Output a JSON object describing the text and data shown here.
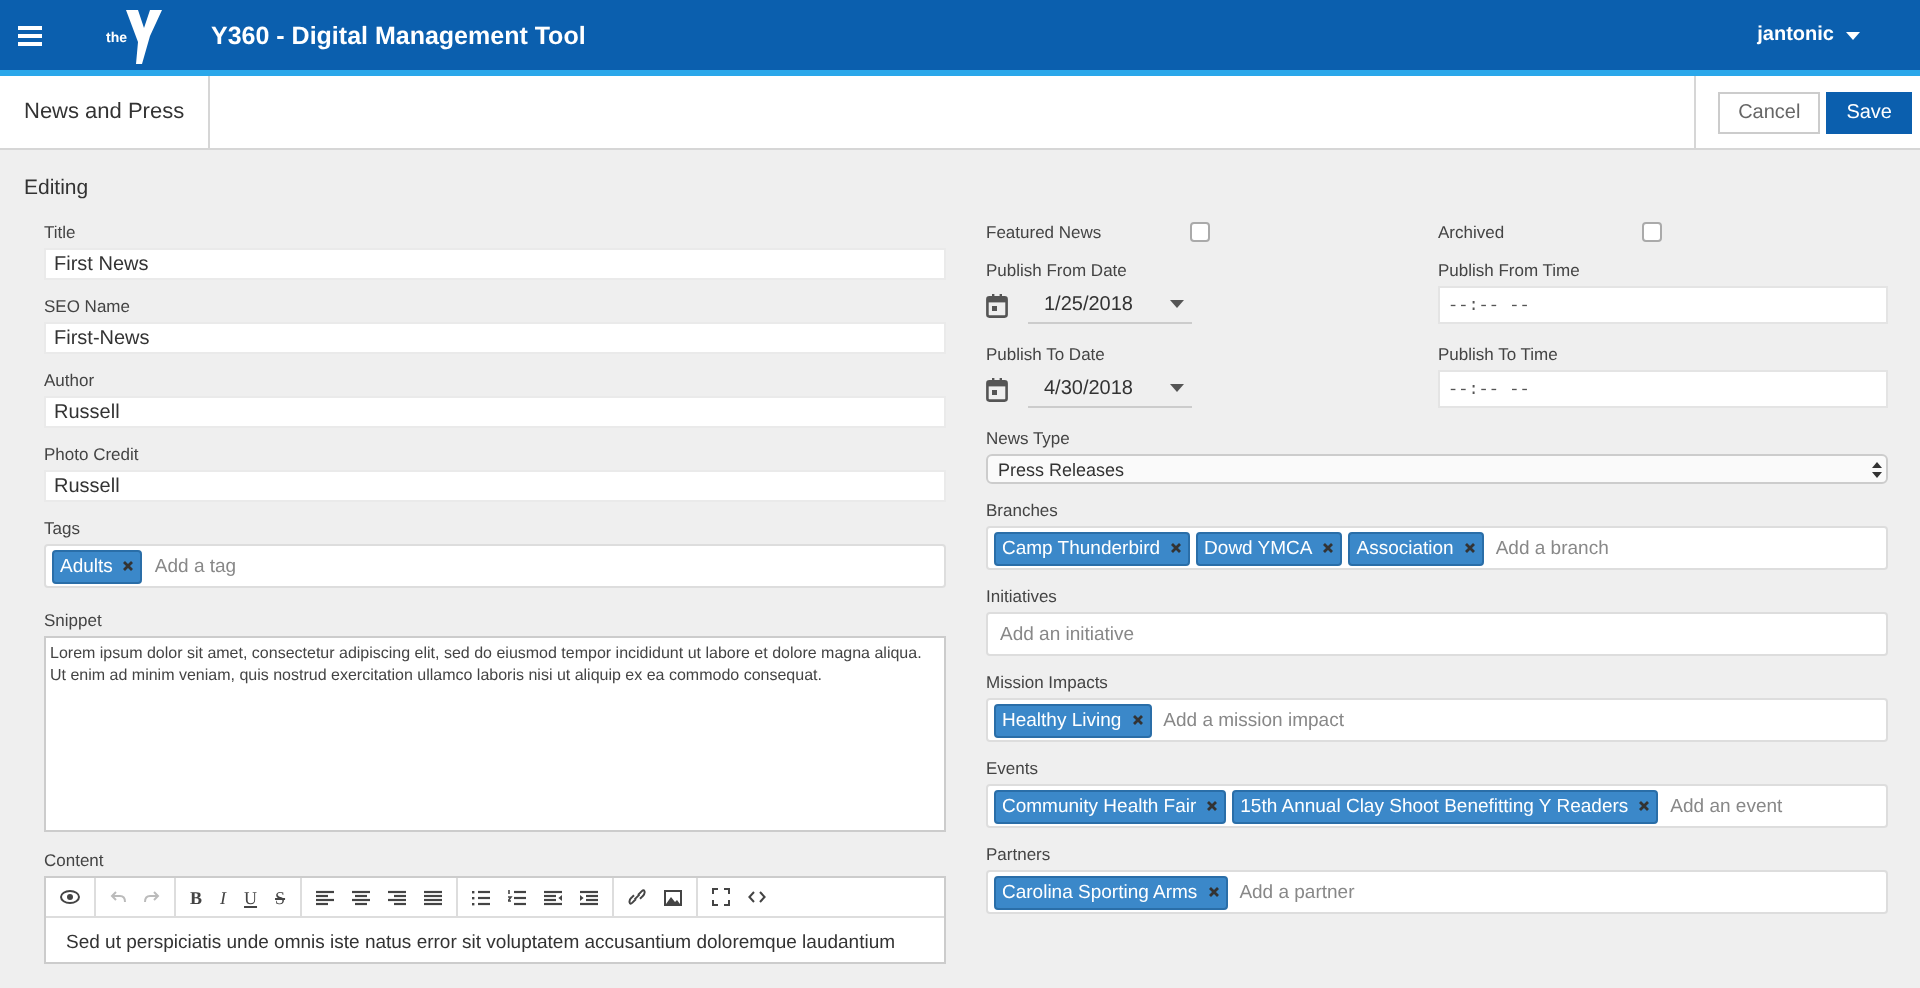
{
  "header": {
    "logo_text": "the",
    "title": "Y360 - Digital Management Tool",
    "user": "jantonic"
  },
  "subheader": {
    "page_title": "News and Press",
    "buttons": [
      {
        "label": "Cancel",
        "primary": false
      },
      {
        "label": "Save",
        "primary": true
      }
    ]
  },
  "section_title": "Editing",
  "left_fields": [
    {
      "kind": "text",
      "label": "Title",
      "value": "First News"
    },
    {
      "kind": "text",
      "label": "SEO Name",
      "value": "First-News"
    },
    {
      "kind": "text",
      "label": "Author",
      "value": "Russell"
    },
    {
      "kind": "text",
      "label": "Photo Credit",
      "value": "Russell"
    },
    {
      "kind": "tags",
      "label": "Tags",
      "tags": [
        "Adults"
      ],
      "placeholder": "Add a tag"
    },
    {
      "kind": "textarea",
      "label": "Snippet",
      "value": "Lorem ipsum dolor sit amet, consectetur adipiscing elit, sed do eiusmod tempor incididunt ut labore et dolore magna aliqua. Ut enim ad minim veniam, quis nostrud exercitation ullamco laboris nisi ut aliquip ex ea commodo consequat."
    },
    {
      "kind": "editor",
      "label": "Content",
      "format_buttons": [
        "B",
        "I",
        "U",
        "S"
      ],
      "value": "Sed ut perspiciatis unde omnis iste natus error sit voluptatem accusantium doloremque laudantium"
    }
  ],
  "right": {
    "checks": [
      {
        "label": "Featured News",
        "checked": false
      },
      {
        "label": "Archived",
        "checked": false
      }
    ],
    "schedule": [
      {
        "date_label": "Publish From Date",
        "date": "1/25/2018",
        "time_label": "Publish From Time",
        "time_placeholder": "--:-- --"
      },
      {
        "date_label": "Publish To Date",
        "date": "4/30/2018",
        "time_label": "Publish To Time",
        "time_placeholder": "--:-- --"
      }
    ],
    "news_type": {
      "label": "News Type",
      "value": "Press Releases"
    },
    "tag_fields": [
      {
        "label": "Branches",
        "tags": [
          "Camp Thunderbird",
          "Dowd YMCA",
          "Association"
        ],
        "placeholder": "Add a branch"
      },
      {
        "label": "Initiatives",
        "placeholder": "Add an initiative"
      },
      {
        "label": "Mission Impacts",
        "tags": [
          "Healthy Living"
        ],
        "placeholder": "Add a mission impact"
      },
      {
        "label": "Events",
        "tags": [
          "Community Health Fair",
          "15th Annual Clay Shoot Benefitting Y Readers"
        ],
        "placeholder": "Add an event"
      },
      {
        "label": "Partners",
        "tags": [
          "Carolina Sporting Arms"
        ],
        "placeholder": "Add a partner"
      }
    ]
  }
}
